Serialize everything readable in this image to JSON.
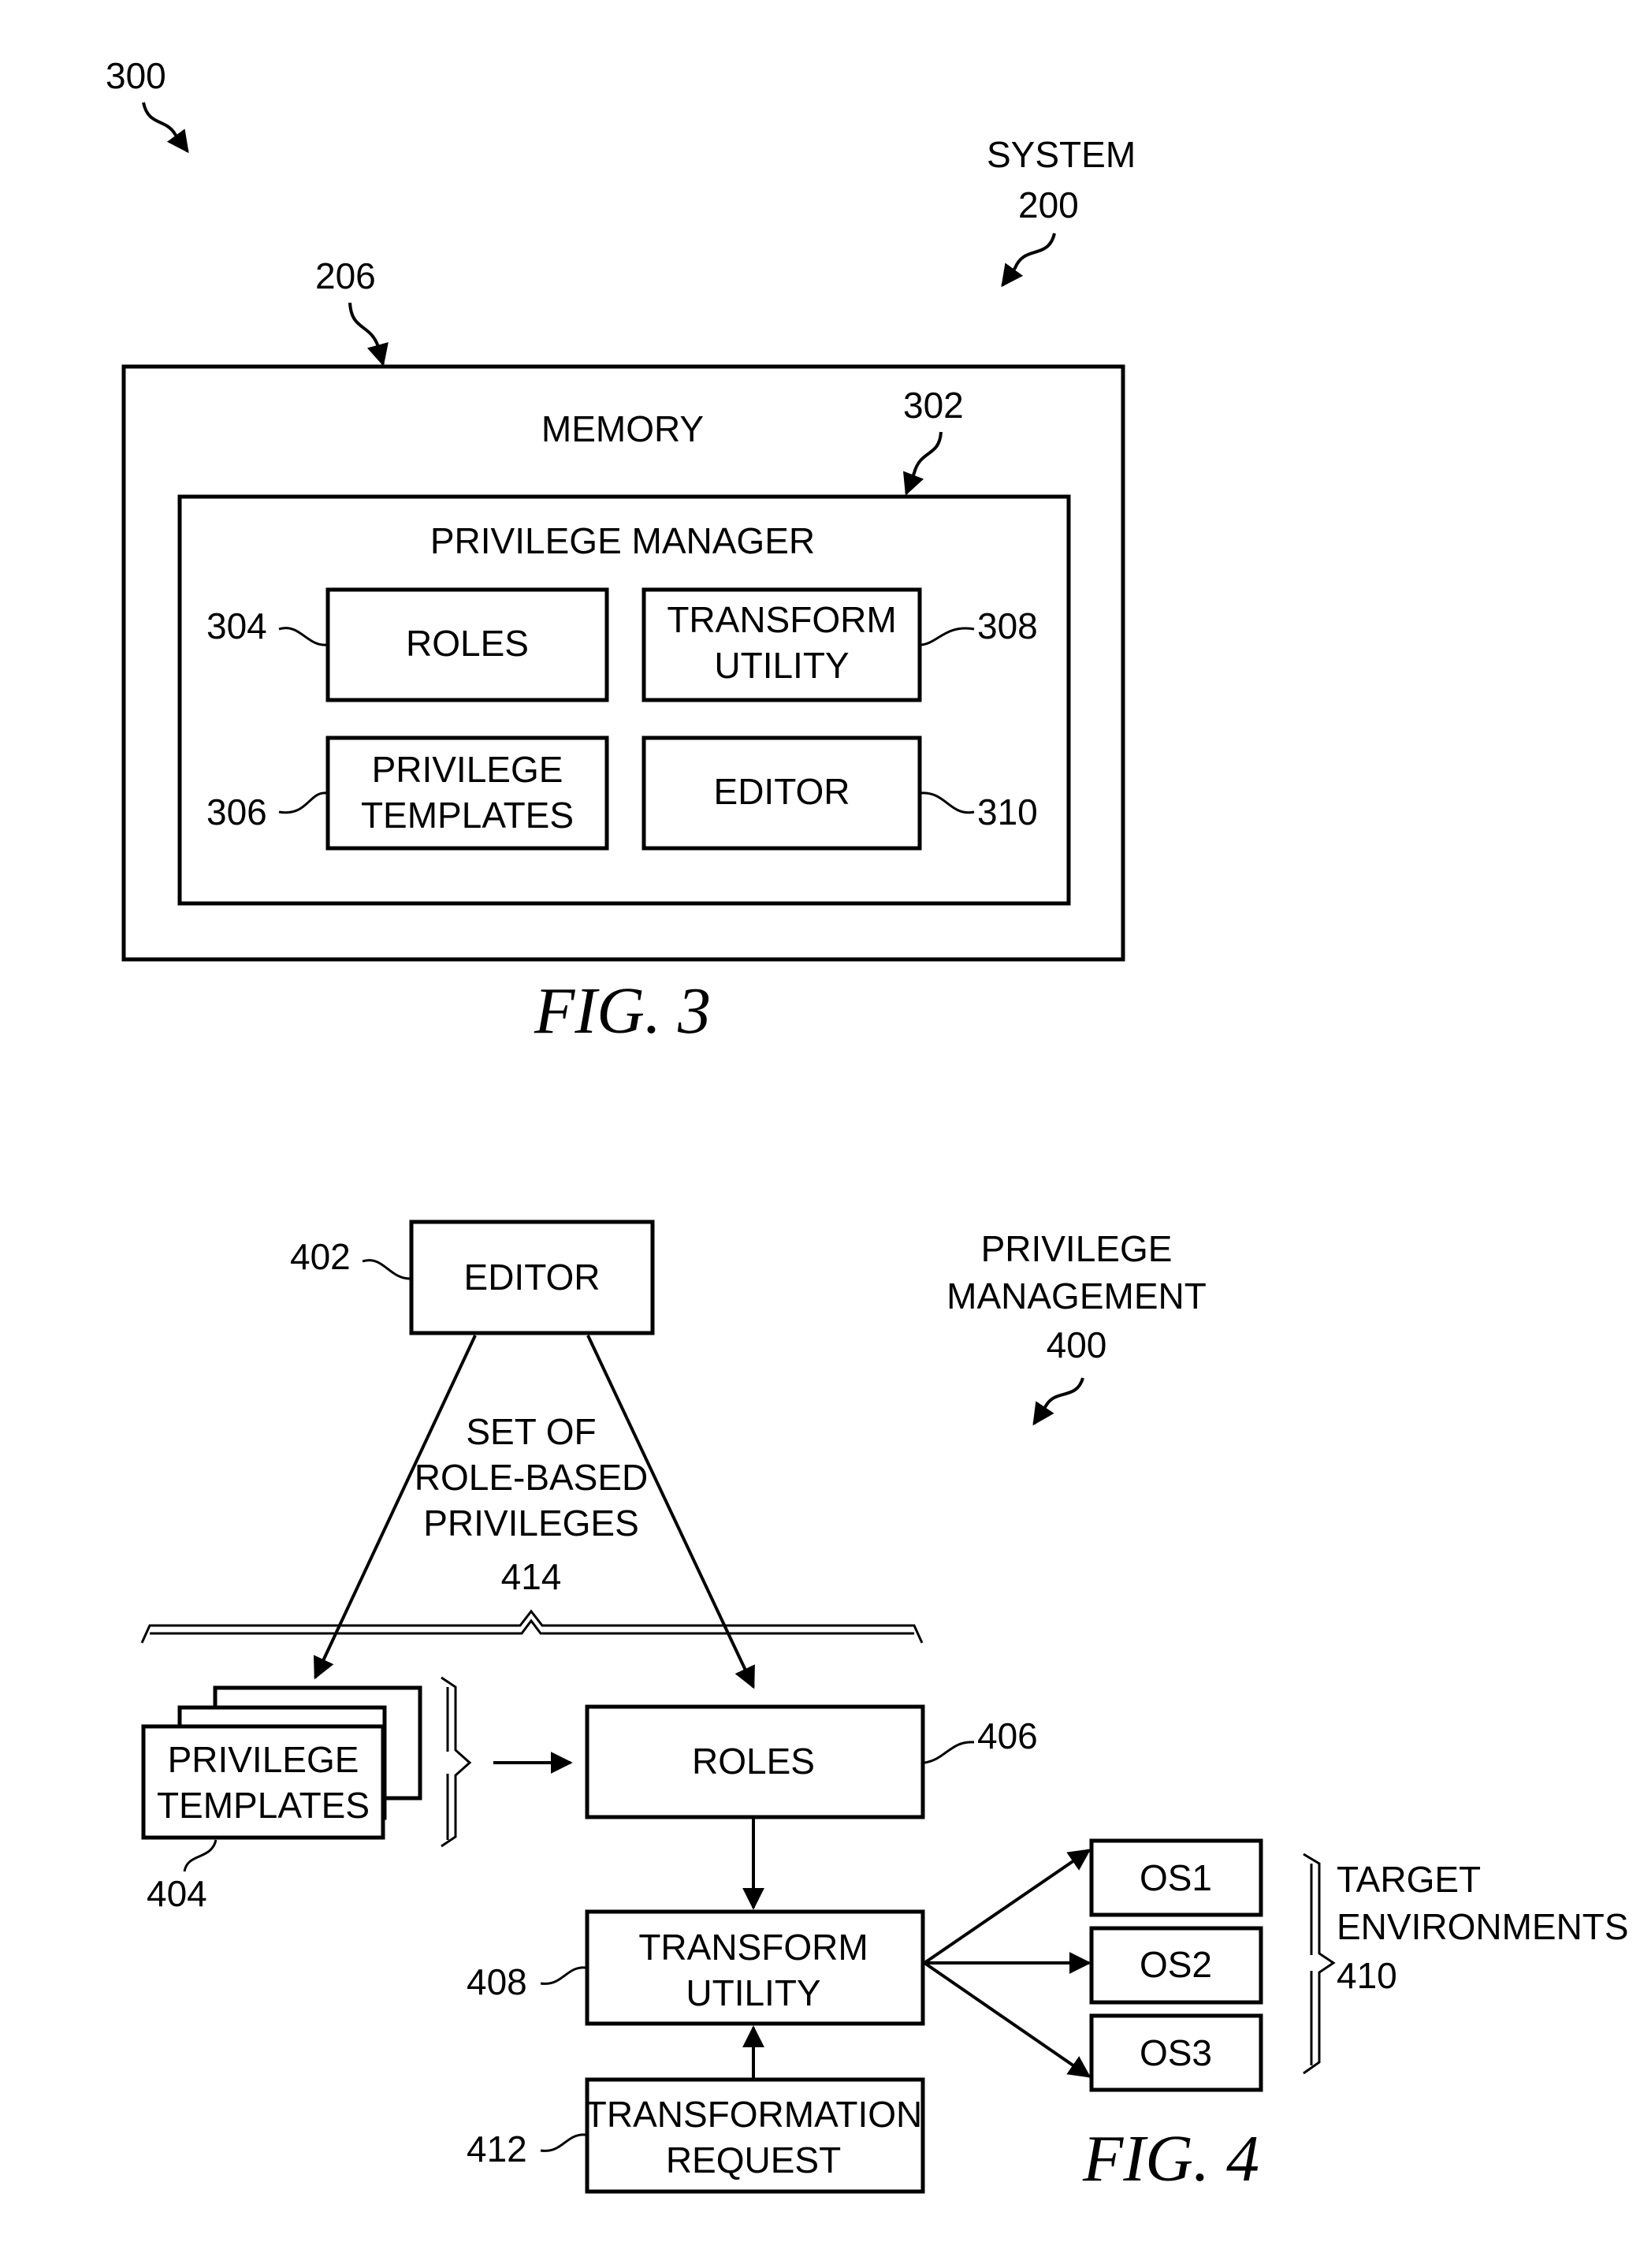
{
  "fig3": {
    "ref_figure": "300",
    "system_label": "SYSTEM",
    "system_ref": "200",
    "memory_ref": "206",
    "memory_label": "MEMORY",
    "privilege_manager_ref": "302",
    "privilege_manager_label": "PRIVILEGE MANAGER",
    "roles": {
      "ref": "304",
      "line1": "ROLES"
    },
    "privilege_templates": {
      "ref": "306",
      "line1": "PRIVILEGE",
      "line2": "TEMPLATES"
    },
    "transform_utility": {
      "ref": "308",
      "line1": "TRANSFORM",
      "line2": "UTILITY"
    },
    "editor": {
      "ref": "310",
      "line1": "EDITOR"
    },
    "caption": "FIG. 3"
  },
  "fig4": {
    "title_line1": "PRIVILEGE",
    "title_line2": "MANAGEMENT",
    "title_ref": "400",
    "editor": {
      "ref": "402",
      "label": "EDITOR"
    },
    "set_label_line1": "SET OF",
    "set_label_line2": "ROLE-BASED",
    "set_label_line3": "PRIVILEGES",
    "set_ref": "414",
    "privilege_templates": {
      "ref": "404",
      "line1": "PRIVILEGE",
      "line2": "TEMPLATES"
    },
    "roles": {
      "ref": "406",
      "label": "ROLES"
    },
    "transform_utility": {
      "ref": "408",
      "line1": "TRANSFORM",
      "line2": "UTILITY"
    },
    "transformation_request": {
      "ref": "412",
      "line1": "TRANSFORMATION",
      "line2": "REQUEST"
    },
    "os_boxes": [
      "OS1",
      "OS2",
      "OS3"
    ],
    "target_line1": "TARGET",
    "target_line2": "ENVIRONMENTS",
    "target_ref": "410",
    "caption": "FIG. 4"
  }
}
